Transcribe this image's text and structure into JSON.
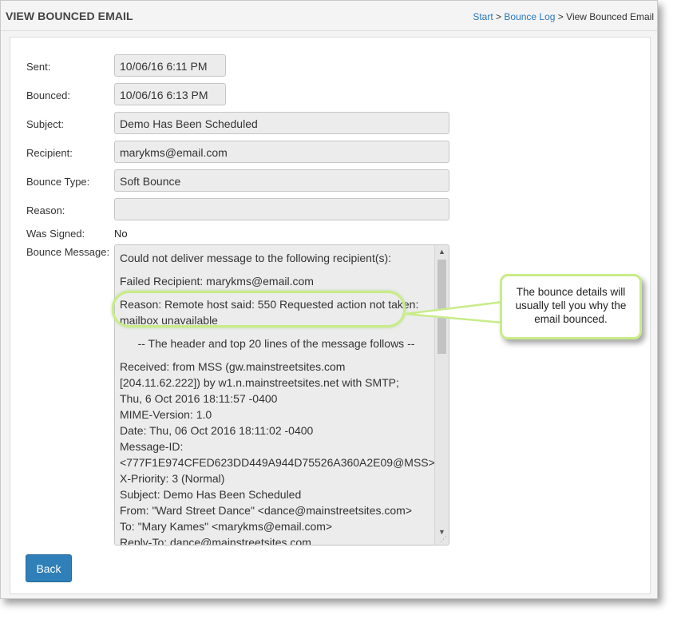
{
  "header": {
    "title": "VIEW BOUNCED EMAIL",
    "breadcrumb": {
      "start": "Start",
      "sep1": ">",
      "bounce_log": "Bounce Log",
      "sep2": ">",
      "current": "View Bounced Email"
    }
  },
  "form": {
    "sent": {
      "label": "Sent:",
      "value": "10/06/16 6:11 PM"
    },
    "bounced": {
      "label": "Bounced:",
      "value": "10/06/16 6:13 PM"
    },
    "subject": {
      "label": "Subject:",
      "value": "Demo Has Been Scheduled"
    },
    "recipient": {
      "label": "Recipient:",
      "value": "marykms@email.com"
    },
    "bounce_type": {
      "label": "Bounce Type:",
      "value": "Soft Bounce"
    },
    "reason": {
      "label": "Reason:",
      "value": ""
    },
    "was_signed": {
      "label": "Was Signed:",
      "value": "No"
    },
    "bounce_message": {
      "label": "Bounce Message:",
      "para1": "Could not deliver message to the following recipient(s):",
      "para2": "Failed Recipient: marykms@email.com",
      "para3": "Reason: Remote host said: 550 Requested action not taken: mailbox unavailable",
      "para4": "-- The header and top 20 lines of the message follows --",
      "headers": [
        "Received: from MSS (gw.mainstreetsites.com",
        "[204.11.62.222]) by w1.n.mainstreetsites.net with SMTP;",
        "   Thu, 6 Oct 2016 18:11:57 -0400",
        "MIME-Version: 1.0",
        "Date: Thu, 06 Oct 2016 18:11:02 -0400",
        "Message-ID:",
        "<777F1E974CFED623DD449A944D75526A360A2E09@MSS>",
        "X-Priority: 3 (Normal)",
        "Subject: Demo Has Been Scheduled",
        "From: \"Ward Street Dance\" <dance@mainstreetsites.com>",
        "To: \"Mary Kames\" <marykms@email.com>",
        "Reply-To: dance@mainstreetsites.com"
      ]
    }
  },
  "actions": {
    "back_label": "Back"
  },
  "callout": {
    "text": "The bounce details will usually tell you why the email bounced."
  },
  "icons": {
    "scroll_up": "chevron-up-icon",
    "scroll_down": "chevron-down-icon",
    "resize": "resize-grip-icon"
  },
  "colors": {
    "accent": "#2f7fb8",
    "link": "#2a78b5",
    "callout_border": "#c8ec88"
  }
}
